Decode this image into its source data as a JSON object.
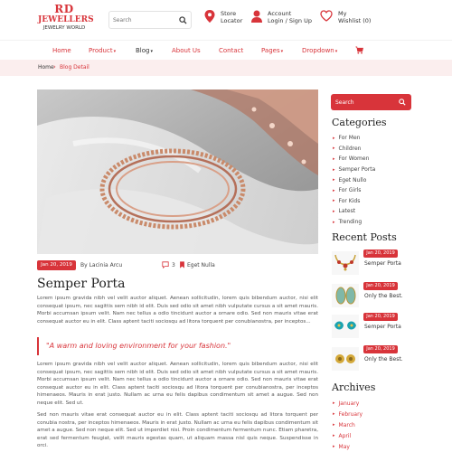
{
  "brand": {
    "line1": "RD",
    "line2": "JEWELLERS",
    "line3": "JEWELRY WORLD"
  },
  "header": {
    "search_placeholder": "Search",
    "store": {
      "line1": "Store",
      "line2": "Locator"
    },
    "account": {
      "line1": "Account",
      "line2": "Login / Sign Up"
    },
    "wishlist": {
      "line1": "My",
      "line2": "Wishlist (0)"
    }
  },
  "nav": {
    "home": "Home",
    "product": "Product",
    "blog": "Blog",
    "about": "About Us",
    "contact": "Contact",
    "pages": "Pages",
    "dropdown": "Dropdown"
  },
  "breadcrumb": {
    "home": "Home",
    "current": "Blog Detail"
  },
  "post": {
    "date": "Jan 20, 2019",
    "author": "By Lacinia Arcu",
    "comments": "3",
    "tag": "Eget Nulla",
    "title": "Semper Porta",
    "p1": "Lorem ipsum gravida nibh vel velit auctor aliquet. Aenean sollicitudin, lorem quis bibendum auctor, nisi elit consequat ipsum, nec sagittis sem nibh id elit. Duis sed odio sit amet nibh vulputate cursus a sit amet mauris. Morbi accumsan ipsum velit. Nam nec tellus a odio tincidunt auctor a ornare odio. Sed non mauris vitae erat consequat auctor eu in elit. Class aptent taciti sociosqu ad litora torquent per conubianostra, per inceptos...",
    "quote": "\"A warm and loving environment for your fashion.\"",
    "p2": "Lorem ipsum gravida nibh vel velit auctor aliquet. Aenean sollicitudin, lorem quis bibendum auctor, nisi elit consequat ipsum, nec sagittis sem nibh id elit. Duis sed odio sit amet nibh vulputate cursus a sit amet mauris. Morbi accumsan ipsum velit. Nam nec tellus a odio tincidunt auctor a ornare odio. Sed non mauris vitae erat consequat auctor eu in elit. Class aptent taciti sociosqu ad litora torquent per conubianostra, per inceptos himenaeos. Mauris in erat justo. Nullam ac urna eu felis dapibus condimentum sit amet a augue. Sed non neque elit. Sed ut.",
    "p3": "Sed non mauris vitae erat consequat auctor eu in elit. Class aptent taciti sociosqu ad litora torquent per conubia nostra, per inceptos himenaeos. Mauris in erat justo. Nullam ac urna eu felis dapibus condimentum sit amet a augue. Sed non neque elit. Sed ut imperdiet nisi. Proin condimentum fermentum nunc. Etiam pharetra, erat sed fermentum feugiat, velit mauris egestas quam, ut aliquam massa nisl quis neque. Suspendisse in orci."
  },
  "sidebar": {
    "search_placeholder": "Search",
    "categories_title": "Categories",
    "categories": [
      "For Men",
      "Children",
      "For Women",
      "Semper Porta",
      "Eget Nullo",
      "For Girls",
      "For Kids",
      "Latest",
      "Trending"
    ],
    "recent_title": "Recent Posts",
    "recent": [
      {
        "date": "Jan 20, 2019",
        "title": "Semper Porta"
      },
      {
        "date": "Jan 20, 2019",
        "title": "Only the Best."
      },
      {
        "date": "Jan 20, 2019",
        "title": "Semper Porta"
      },
      {
        "date": "Jan 20, 2019",
        "title": "Only the Best."
      }
    ],
    "archives_title": "Archives",
    "archives": [
      "January",
      "February",
      "March",
      "April",
      "May"
    ]
  },
  "colors": {
    "accent": "#d8343a",
    "breadcrumb_bg": "#fbeeee"
  }
}
